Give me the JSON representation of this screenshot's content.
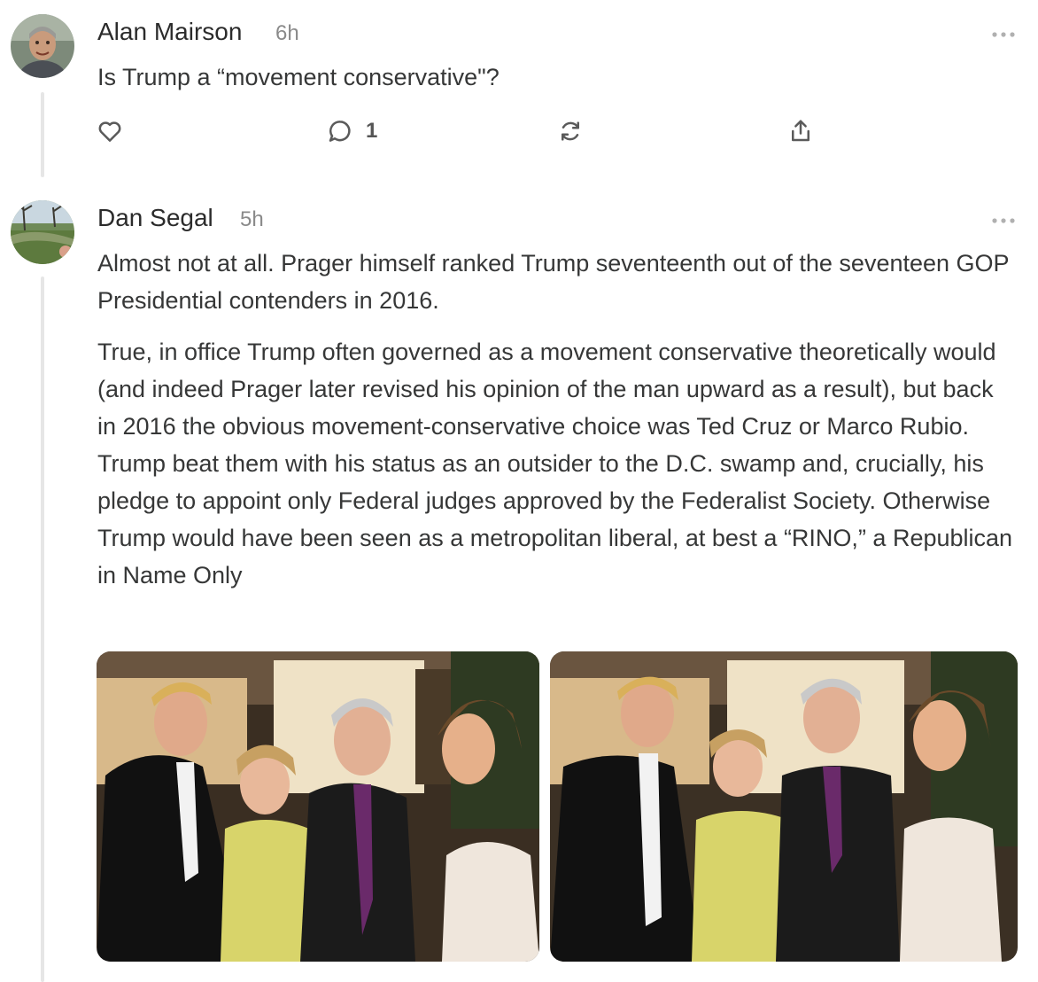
{
  "comments": [
    {
      "author": "Alan Mairson",
      "time": "6h",
      "body": "Is Trump a “movement conservative\"?",
      "reply_count": "1"
    },
    {
      "author": "Dan Segal",
      "time": "5h",
      "paragraphs": [
        "Almost not at all. Prager himself ranked Trump seventeenth out of the seventeen GOP Presidential contenders in 2016.",
        "True, in office Trump often governed as a movement conservative theoretically would (and indeed Prager later revised his opinion of the man upward as a result), but back in 2016 the obvious movement-conservative choice was Ted Cruz or Marco Rubio. Trump beat them with his status as an outsider to the D.C. swamp and, crucially, his pledge to appoint only Federal judges approved by the Federalist Society. Otherwise Trump would have been seen as a metropolitan liberal, at best a “RINO,” a Republican in Name Only"
      ]
    }
  ],
  "icons": [
    "more-options-icon",
    "heart-icon",
    "comment-icon",
    "restack-icon",
    "share-icon"
  ],
  "colors": {
    "text": "#363737",
    "muted": "#8a8a8a",
    "thread_line": "#e6e6e6",
    "icon": "#5a5a5a"
  }
}
